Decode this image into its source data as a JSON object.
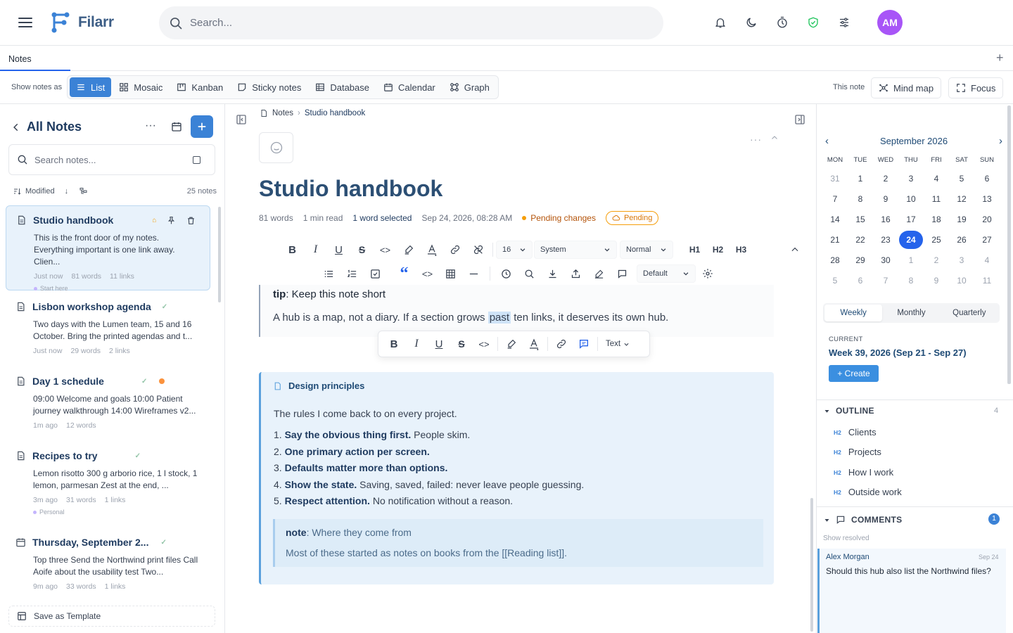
{
  "app": {
    "name": "Filarr",
    "search_placeholder": "Search...",
    "user_initials": "AM"
  },
  "tabs": {
    "notes": "Notes"
  },
  "views": {
    "label": "Show notes as",
    "items": [
      "List",
      "Mosaic",
      "Kanban",
      "Sticky notes",
      "Database",
      "Calendar",
      "Graph"
    ],
    "active": "List",
    "this_note_label": "This note",
    "mind_map": "Mind map",
    "focus": "Focus"
  },
  "notes_panel": {
    "title": "All Notes",
    "search_placeholder": "Search notes...",
    "sort_label": "Modified",
    "count": "25 notes",
    "save_template": "Save as Template",
    "notes": [
      {
        "title": "Studio handbook",
        "body": "This is the front door of my notes. Everything important is one link away. Clien...",
        "time": "Just now",
        "words": "81 words",
        "links": "11 links",
        "tag": "Start here"
      },
      {
        "title": "Lisbon workshop agenda",
        "body": "Two days with the Lumen team, 15 and 16 October. Bring the printed agendas and t...",
        "time": "Just now",
        "words": "29 words",
        "links": "2 links"
      },
      {
        "title": "Day 1 schedule",
        "body": "09:00 Welcome and goals 10:00 Patient journey walkthrough 14:00 Wireframes v2...",
        "time": "1m ago",
        "words": "12 words"
      },
      {
        "title": "Recipes to try",
        "body": "Lemon risotto 300 g arborio rice, 1 l stock, 1 lemon, parmesan Zest at the end, ...",
        "time": "3m ago",
        "words": "31 words",
        "links": "1 links",
        "tag": "Personal"
      },
      {
        "title": "Thursday, September 2...",
        "body": "Top three Send the Northwind print files Call Aoife about the usability test Two...",
        "time": "9m ago",
        "words": "33 words",
        "links": "1 links"
      }
    ]
  },
  "editor": {
    "breadcrumb": [
      "Notes",
      "Studio handbook"
    ],
    "title": "Studio handbook",
    "meta": {
      "words": "81 words",
      "read": "1 min read",
      "selected": "1 word selected",
      "date": "Sep 24, 2026, 08:28 AM",
      "pending_changes": "Pending changes",
      "pending_badge": "Pending"
    },
    "toolbar": {
      "font_size": "16",
      "font_family": "System",
      "style": "Normal",
      "h1": "H1",
      "h2": "H2",
      "h3": "H3",
      "theme": "Default"
    },
    "float_toolbar": {
      "text": "Text"
    },
    "tip_label": "tip",
    "tip_text": ": Keep this note short",
    "para_before": "A hub is a map, not a diary. If a section grows ",
    "para_hl": "past",
    "para_after": " ten links, it deserves its own hub.",
    "callout": {
      "title": "Design principles",
      "intro": "The rules I come back to on every project.",
      "items": [
        {
          "bold": "Say the obvious thing first.",
          "rest": " People skim."
        },
        {
          "bold": "One primary action per screen.",
          "rest": ""
        },
        {
          "bold": "Defaults matter more than options.",
          "rest": ""
        },
        {
          "bold": "Show the state.",
          "rest": " Saving, saved, failed: never leave people guessing."
        },
        {
          "bold": "Respect attention.",
          "rest": " No notification without a reason."
        }
      ],
      "note_label": "note",
      "note_text": ": Where they come from",
      "note_body": "Most of these started as notes on books from the [[Reading list]]."
    }
  },
  "calendar": {
    "month": "September 2026",
    "dow": [
      "MON",
      "TUE",
      "WED",
      "THU",
      "FRI",
      "SAT",
      "SUN"
    ],
    "days": [
      31,
      1,
      2,
      3,
      4,
      5,
      6,
      7,
      8,
      9,
      10,
      11,
      12,
      13,
      14,
      15,
      16,
      17,
      18,
      19,
      20,
      21,
      22,
      23,
      24,
      25,
      26,
      27,
      28,
      29,
      30,
      1,
      2,
      3,
      4,
      5,
      6,
      7,
      8,
      9,
      10,
      11
    ],
    "today": 24,
    "periods": [
      "Weekly",
      "Monthly",
      "Quarterly"
    ],
    "active_period": "Weekly",
    "current_label": "CURRENT",
    "week": "Week 39, 2026 (Sep 21 - Sep 27)",
    "create": "+ Create"
  },
  "outline": {
    "title": "OUTLINE",
    "count": "4",
    "items": [
      "Clients",
      "Projects",
      "How I work",
      "Outside work"
    ],
    "level": "H2"
  },
  "comments": {
    "title": "COMMENTS",
    "count": "1",
    "show_resolved": "Show resolved",
    "items": [
      {
        "author": "Alex Morgan",
        "date": "Sep 24",
        "text": "Should this hub also list the Northwind files?"
      }
    ]
  },
  "colors": {
    "accent": "#3b82d6",
    "title": "#2c4f74",
    "pending": "#f59e0b",
    "avatar": "#a855f7"
  }
}
